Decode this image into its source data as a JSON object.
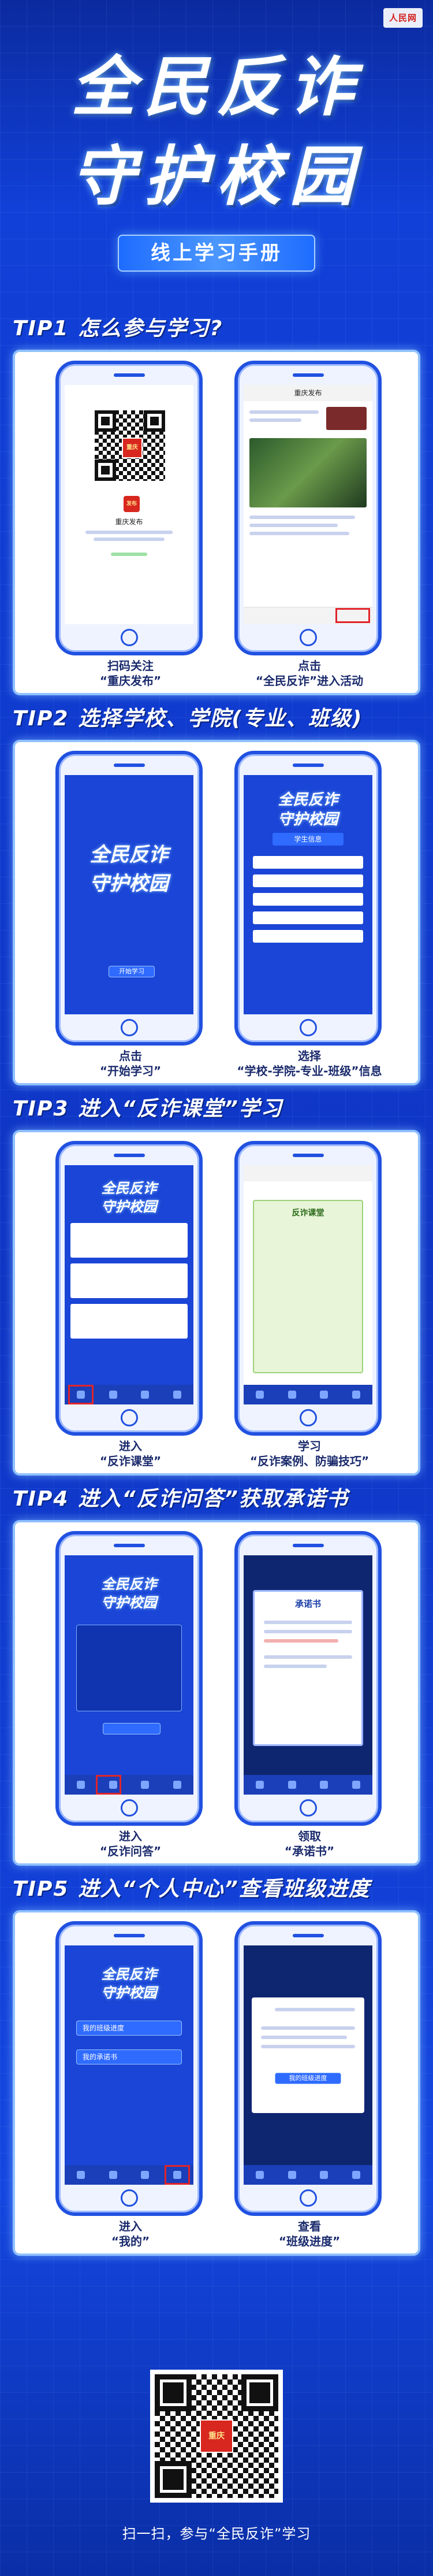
{
  "header": {
    "logo_text": "人民网",
    "title_line1": "全民反诈",
    "title_line2": "守护校园",
    "subtitle": "线上学习手册"
  },
  "tips": [
    {
      "number": "TIP1",
      "title": "怎么参与学习?",
      "captions": [
        {
          "line1": "扫码关注",
          "line2": "“重庆发布”"
        },
        {
          "line1": "点击",
          "line2": "“全民反诈”进入活动"
        }
      ]
    },
    {
      "number": "TIP2",
      "title": "选择学校、学院(专业、班级)",
      "captions": [
        {
          "line1": "点击",
          "line2": "“开始学习”"
        },
        {
          "line1": "选择",
          "line2": "“学校-学院-专业-班级”信息"
        }
      ]
    },
    {
      "number": "TIP3",
      "title": "进入“反诈课堂”学习",
      "captions": [
        {
          "line1": "进入",
          "line2": "“反诈课堂”"
        },
        {
          "line1": "学习",
          "line2": "“反诈案例、防骗技巧”"
        }
      ]
    },
    {
      "number": "TIP4",
      "title": "进入“反诈问答”获取承诺书",
      "captions": [
        {
          "line1": "进入",
          "line2": "“反诈问答”"
        },
        {
          "line1": "领取",
          "line2": "“承诺书”"
        }
      ]
    },
    {
      "number": "TIP5",
      "title": "进入“个人中心”查看班级进度",
      "captions": [
        {
          "line1": "进入",
          "line2": "“我的”"
        },
        {
          "line1": "查看",
          "line2": "“班级进度”"
        }
      ]
    }
  ],
  "screens": {
    "tip1_left_account": "重庆发布",
    "tip1_right_header": "重庆发布",
    "tip2_start_btn": "开始学习",
    "tip2_form_title": "学生信息",
    "tip3_course_title": "反诈课堂",
    "tip4_letter_title": "承诺书",
    "tip5_progress_btn": "我的班级进度",
    "tip5_letter_btn": "我的承诺书",
    "tip5_panel_btn": "我的班级进度"
  },
  "footer": {
    "text": "扫一扫，参与“全民反诈”学习"
  },
  "colors": {
    "background": "#1140d8",
    "accent": "#4b97ff",
    "highlight": "#e0242a"
  }
}
